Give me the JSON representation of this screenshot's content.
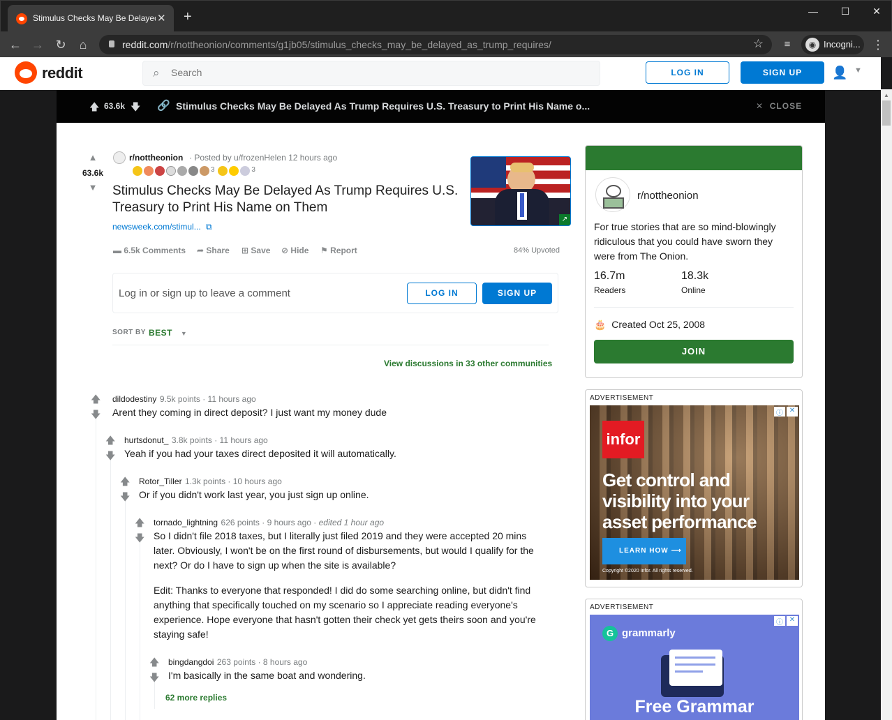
{
  "browser": {
    "tab_title": "Stimulus Checks May Be Delayed As Trump Requires",
    "url_host": "reddit.com",
    "url_path": "/r/nottheonion/comments/g1jb05/stimulus_checks_may_be_delayed_as_trump_requires/",
    "profile_label": "Incogni..."
  },
  "header": {
    "brand": "reddit",
    "search_placeholder": "Search",
    "login": "LOG IN",
    "signup": "SIGN UP"
  },
  "overlay": {
    "score": "63.6k",
    "title": "Stimulus Checks May Be Delayed As Trump Requires U.S. Treasury to Print His Name o...",
    "close": "CLOSE"
  },
  "post": {
    "score": "63.6k",
    "subreddit": "r/nottheonion",
    "posted_by": "· Posted by u/frozenHelen 12 hours ago",
    "award_counts": [
      "3",
      "3"
    ],
    "title": "Stimulus Checks May Be Delayed As Trump Requires U.S. Treasury to Print His Name on Them",
    "domain": "newsweek.com/stimul...",
    "comments": "6.5k Comments",
    "share": "Share",
    "save": "Save",
    "hide": "Hide",
    "report": "Report",
    "upvoted": "84% Upvoted"
  },
  "comment_box": {
    "prompt": "Log in or sign up to leave a comment",
    "login": "LOG IN",
    "signup": "SIGN UP"
  },
  "sort": {
    "label": "SORT BY",
    "value": "BEST"
  },
  "other_communities": "View discussions in 33 other communities",
  "comments": [
    {
      "author": "dildodestiny",
      "meta": "9.5k points · 11 hours ago",
      "text": "Arent they coming in direct deposit? I just want my money dude"
    },
    {
      "author": "hurtsdonut_",
      "meta": "3.8k points · 11 hours ago",
      "text": "Yeah if you had your taxes direct deposited it will automatically."
    },
    {
      "author": "Rotor_Tiller",
      "meta": "1.3k points · 10 hours ago",
      "text": "Or if you didn't work last year, you just sign up online."
    },
    {
      "author": "tornado_lightning",
      "meta": "626 points · 9 hours ago · ",
      "edited": "edited 1 hour ago",
      "text1": "So I didn't file 2018 taxes, but I literally just filed 2019 and they were accepted 20 mins later. Obviously, I won't be on the first round of disbursements, but would I qualify for the next? Or do I have to sign up when the site is available?",
      "text2": "Edit: Thanks to everyone that responded! I did do some searching online, but didn't find anything that specifically touched on my scenario so I appreciate reading everyone's experience. Hope everyone that hasn't gotten their check yet gets theirs soon and you're staying safe!"
    },
    {
      "author": "bingdangdoi",
      "meta": "263 points · 8 hours ago",
      "text": "I'm basically in the same boat and wondering."
    }
  ],
  "more_replies": "62 more replies",
  "sidebar": {
    "name": "r/nottheonion",
    "description": "For true stories that are so mind-blowingly ridiculous that you could have sworn they were from The Onion.",
    "readers_value": "16.7m",
    "readers_label": "Readers",
    "online_value": "18.3k",
    "online_label": "Online",
    "created": "Created Oct 25, 2008",
    "join": "JOIN"
  },
  "ads": [
    {
      "label": "ADVERTISEMENT",
      "brand": "infor",
      "headline": "Get control and visibility into your asset performance",
      "cta": "LEARN HOW",
      "copyright": "Copyright ©2020 Infor. All rights reserved."
    },
    {
      "label": "ADVERTISEMENT",
      "brand": "grammarly",
      "headline": "Free Grammar"
    }
  ],
  "colors": {
    "reddit_orange": "#ff4500",
    "blue": "#0079d3",
    "community_green": "#2b7a30",
    "overlay_bg": "#030303"
  }
}
